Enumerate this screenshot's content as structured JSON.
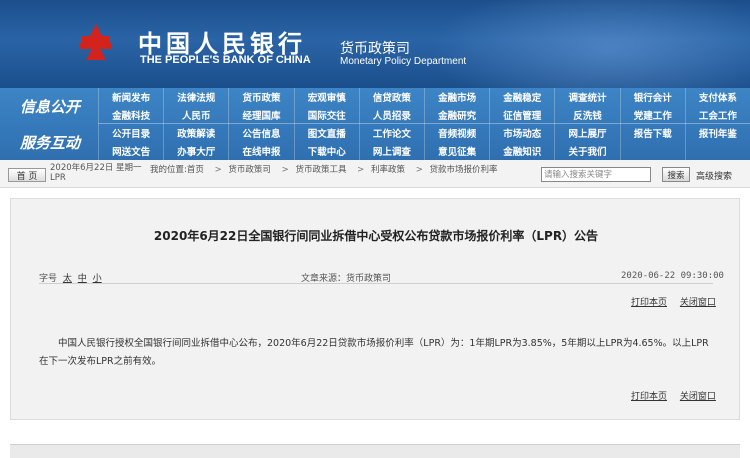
{
  "header": {
    "cn_name": "中国人民银行",
    "en_name": "THE PEOPLE'S BANK OF CHINA",
    "dept_cn": "货币政策司",
    "dept_en": "Monetary Policy Department"
  },
  "nav": {
    "group_top": "信息公开",
    "group_bottom": "服务互动",
    "items": [
      "新闻发布",
      "法律法规",
      "货币政策",
      "宏观审慎",
      "信贷政策",
      "金融市场",
      "金融稳定",
      "调查统计",
      "银行会计",
      "支付体系",
      "金融科技",
      "人民币",
      "经理国库",
      "国际交往",
      "人员招录",
      "金融研究",
      "征信管理",
      "反洗钱",
      "党建工作",
      "工会工作",
      "公开目录",
      "政策解读",
      "公告信息",
      "图文直播",
      "工作论文",
      "音频视频",
      "市场动态",
      "网上展厅",
      "报告下载",
      "报刊年鉴",
      "网送文告",
      "办事大厅",
      "在线申报",
      "下载中心",
      "网上调查",
      "意见征集",
      "金融知识",
      "关于我们",
      "",
      ""
    ]
  },
  "util": {
    "home_label": "首 页",
    "date_line1": "2020年6月22日 星期一",
    "date_line2": "LPR",
    "location_label": "我的位置:首页",
    "crumbs": [
      "货币政策司",
      "货币政策工具",
      "利率政策",
      "贷款市场报价利率"
    ],
    "search_placeholder": "请输入搜索关键字",
    "search_label": "搜索",
    "advanced_label": "高级搜索"
  },
  "article": {
    "title": "2020年6月22日全国银行间同业拆借中心受权公布贷款市场报价利率（LPR）公告",
    "size_label": "字号",
    "size_large": "太",
    "size_medium": "中",
    "size_small": "小",
    "source": "文章来源：货币政策司",
    "date": "2020-06-22 09:30:00",
    "print_label": "打印本页",
    "close_label": "关闭窗口",
    "body": "中国人民银行授权全国银行间同业拆借中心公布，2020年6月22日贷款市场报价利率（LPR）为：1年期LPR为3.85%，5年期以上LPR为4.65%。以上LPR在下一次发布LPR之前有效。"
  },
  "colors": {
    "banner": "#1b4f8c",
    "nav": "#3d85c6",
    "logo_red": "#d2231d"
  }
}
